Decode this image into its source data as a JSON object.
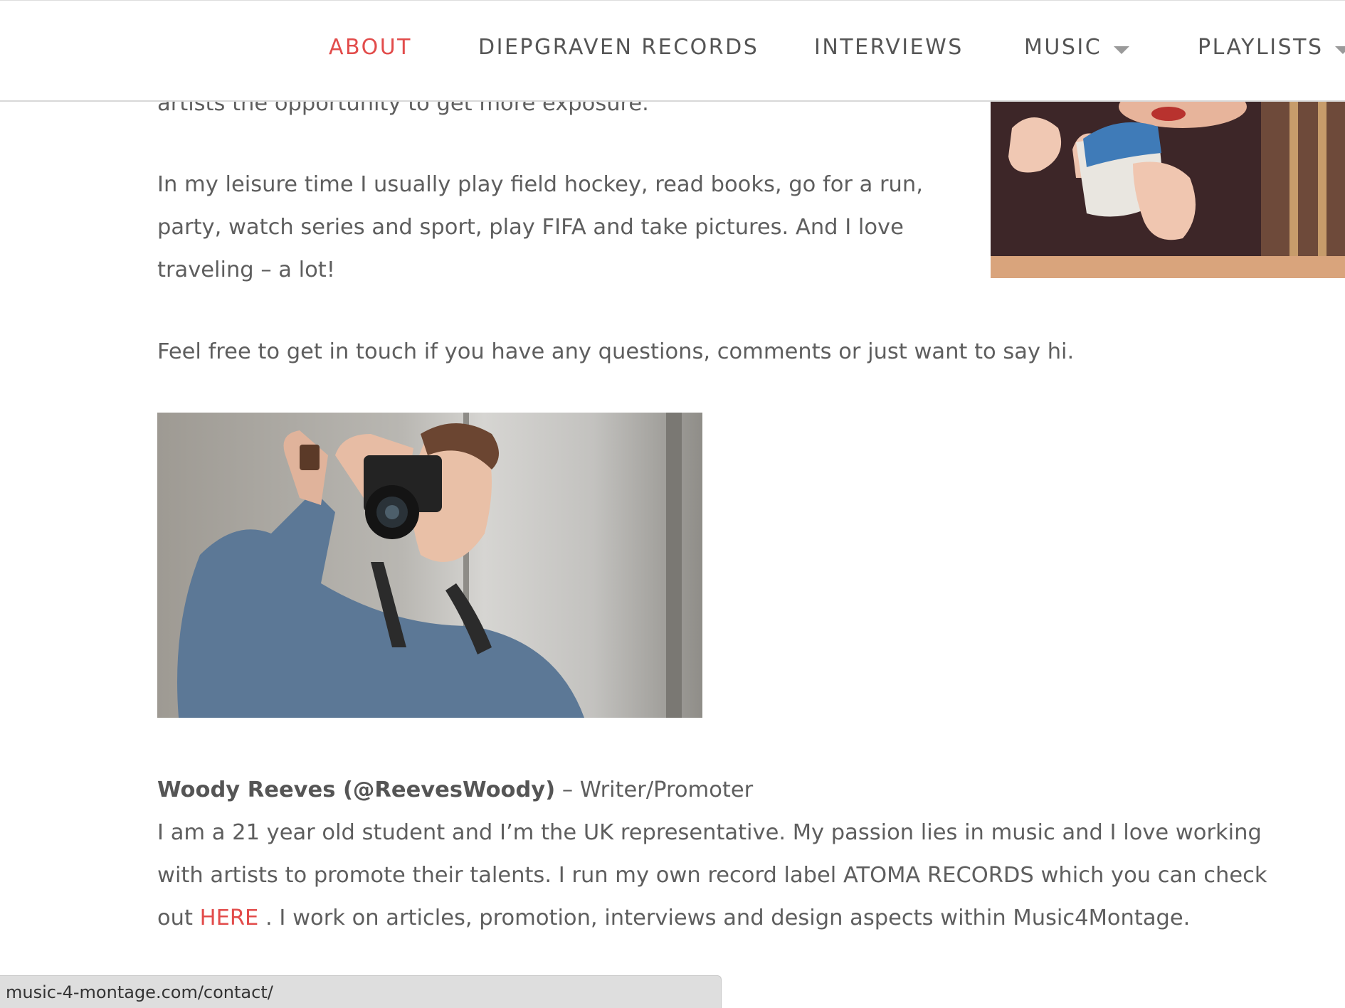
{
  "nav": {
    "items": [
      {
        "label": "ABOUT"
      },
      {
        "label": "DIEPGRAVEN RECORDS"
      },
      {
        "label": "INTERVIEWS"
      },
      {
        "label": "MUSIC"
      },
      {
        "label": "PLAYLISTS"
      }
    ]
  },
  "content": {
    "intro_tail": "artists the opportunity to get more exposure.",
    "leisure": {
      "line1": "In my leisure time I usually play field hockey, read books, go for a run,",
      "line2": "party, watch series and sport, play FIFA and take pictures. And I love",
      "line3": "traveling – a lot!"
    },
    "contact_note": "Feel free to get in touch if you have any questions, comments or just want to say hi.",
    "profile": {
      "name": "Woody Reeves (@ReevesWoody)",
      "role_suffix": " – Writer/Promoter",
      "bio_line1": "I am a 21 year old student and I’m the UK representative. My passion lies in music and I love working",
      "bio_line2": "with artists to promote their talents. I run my own record label ATOMA RECORDS which you can check",
      "bio_line3_prefix": "out ",
      "bio_link": "HERE",
      "bio_line3_suffix": " . I work on articles, promotion, interviews and design aspects within Music4Montage."
    }
  },
  "status_bar": {
    "url": "music-4-montage.com/contact/"
  },
  "colors": {
    "accent": "#e24c4b",
    "text": "#5e5e5e",
    "nav_text": "#555555"
  },
  "icons": {
    "dropdown": "caret-down-icon"
  }
}
